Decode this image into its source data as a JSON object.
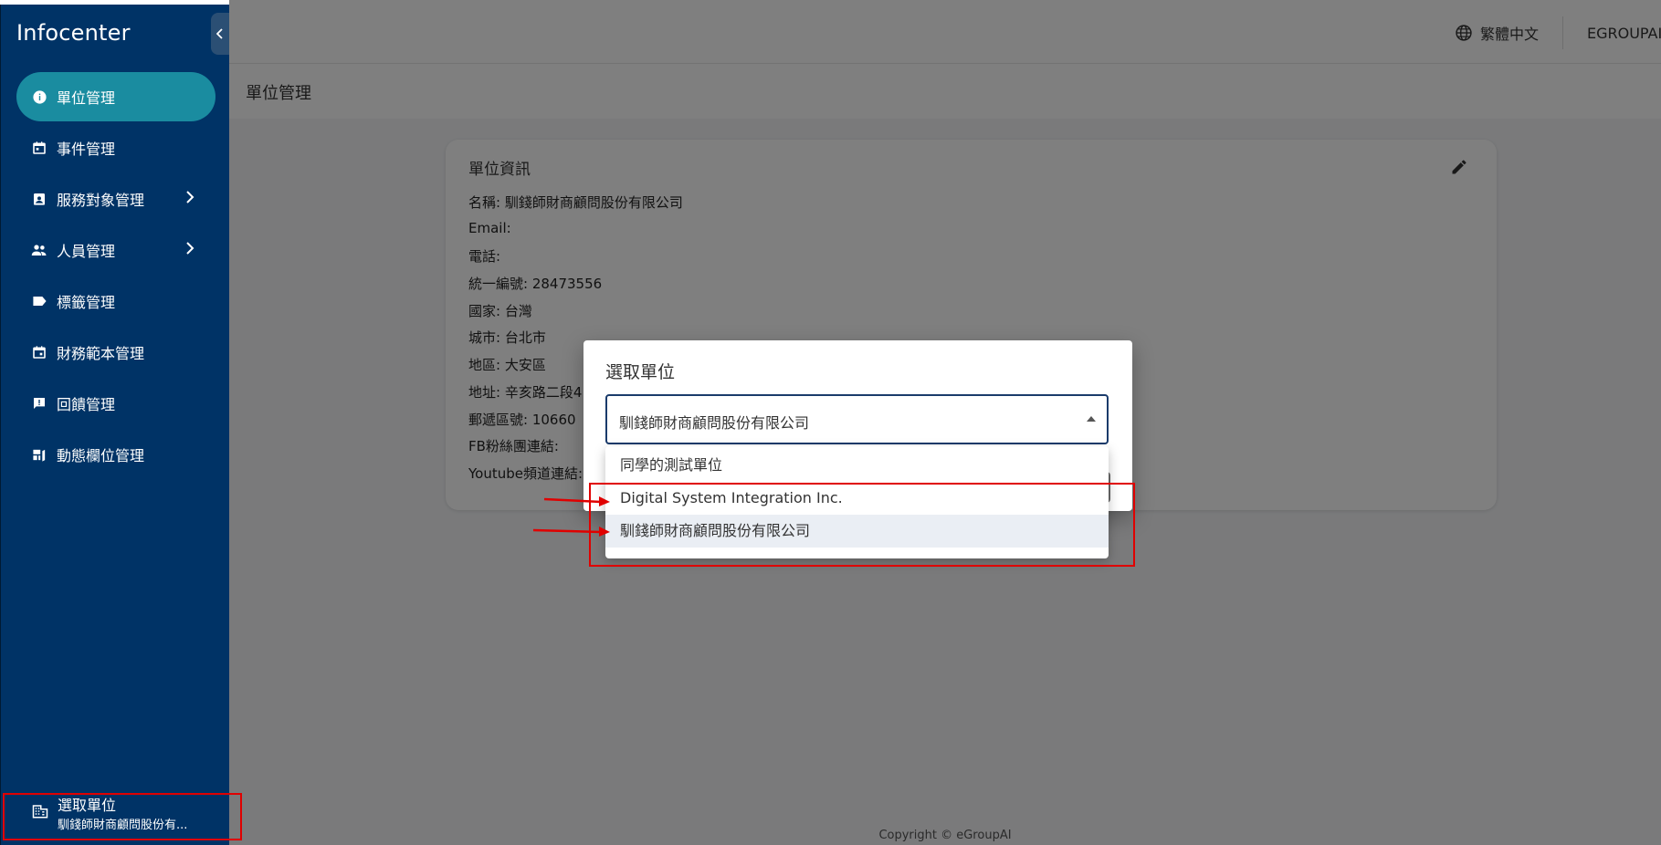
{
  "app": {
    "title": "Infocenter"
  },
  "sidebar": {
    "items": [
      {
        "label": "單位管理",
        "icon": "info-icon",
        "active": true
      },
      {
        "label": "事件管理",
        "icon": "calendar-icon"
      },
      {
        "label": "服務對象管理",
        "icon": "contact-icon",
        "expandable": true
      },
      {
        "label": "人員管理",
        "icon": "people-icon",
        "expandable": true
      },
      {
        "label": "標籤管理",
        "icon": "label-icon"
      },
      {
        "label": "財務範本管理",
        "icon": "calendar-icon"
      },
      {
        "label": "回饋管理",
        "icon": "feedback-icon"
      },
      {
        "label": "動態欄位管理",
        "icon": "dynamic-field-icon"
      }
    ],
    "select_unit": {
      "label": "選取單位",
      "value": "馴錢師財商顧問股份有..."
    }
  },
  "header": {
    "language": "繁體中文",
    "user": "EGROUPAI"
  },
  "page": {
    "title": "單位管理"
  },
  "card": {
    "title": "單位資訊",
    "lines": [
      "名稱: 馴錢師財商顧問股份有限公司",
      "Email:",
      "電話:",
      "統一編號: 28473556",
      "國家: 台灣",
      "城市: 台北市",
      "地區: 大安區",
      "地址: 辛亥路二段4",
      "郵遞區號: 10660",
      "FB粉絲團連結:",
      "Youtube頻道連結:"
    ]
  },
  "dialog": {
    "title": "選取單位",
    "selected": "馴錢師財商顧問股份有限公司",
    "options": [
      "同學的測試單位",
      "Digital System Integration Inc.",
      "馴錢師財商顧問股份有限公司"
    ]
  },
  "footer": {
    "copyright": "Copyright © eGroupAI"
  },
  "colors": {
    "sidebar": "#003366",
    "active": "#1a8ca0",
    "annotation": "#e00000"
  }
}
